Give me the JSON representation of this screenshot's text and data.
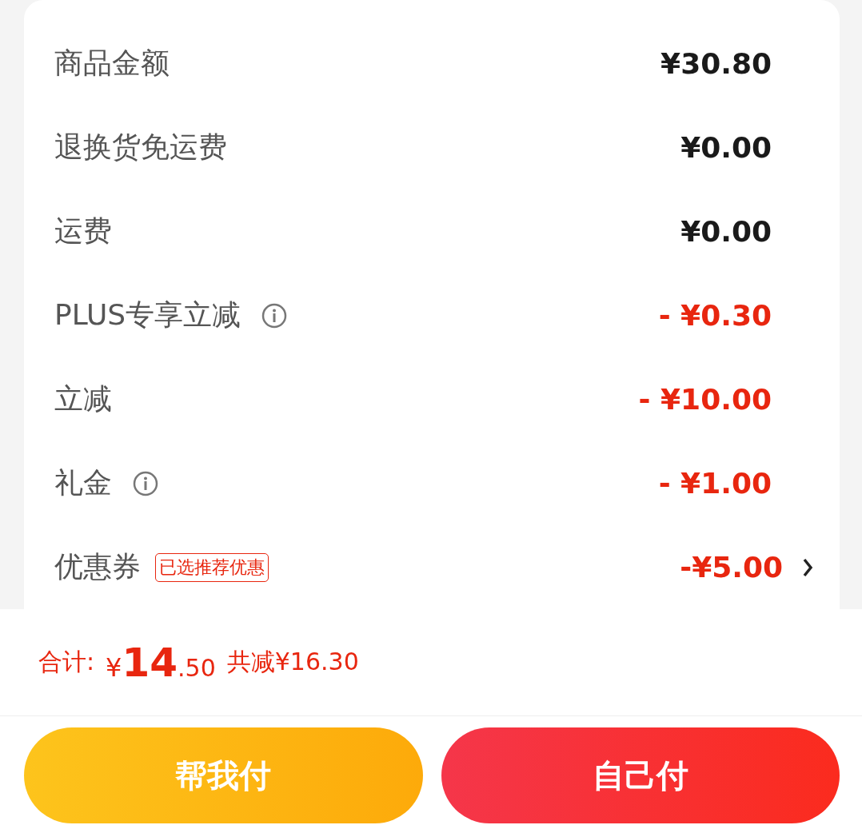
{
  "summary_rows": [
    {
      "label": "商品金额",
      "value": "¥30.80",
      "kind": "plain",
      "info": false
    },
    {
      "label": "退换货免运费",
      "value": "¥0.00",
      "kind": "plain",
      "info": false
    },
    {
      "label": "运费",
      "value": "¥0.00",
      "kind": "plain",
      "info": false
    },
    {
      "label": "PLUS专享立减",
      "value": "- ¥0.30",
      "kind": "discount",
      "info": true
    },
    {
      "label": "立减",
      "value": "- ¥10.00",
      "kind": "discount",
      "info": false
    },
    {
      "label": "礼金",
      "value": "- ¥1.00",
      "kind": "discount",
      "info": true
    },
    {
      "label": "优惠券",
      "tag": "已选推荐优惠",
      "value": "-¥5.00",
      "kind": "discount",
      "info": false,
      "link": true
    }
  ],
  "total": {
    "label": "合计:",
    "currency": "¥",
    "integer": "14",
    "decimal": ".50",
    "saved": "共减¥16.30"
  },
  "buttons": [
    {
      "label": "帮我付",
      "kind": "secondary"
    },
    {
      "label": "自己付",
      "kind": "primary"
    }
  ]
}
